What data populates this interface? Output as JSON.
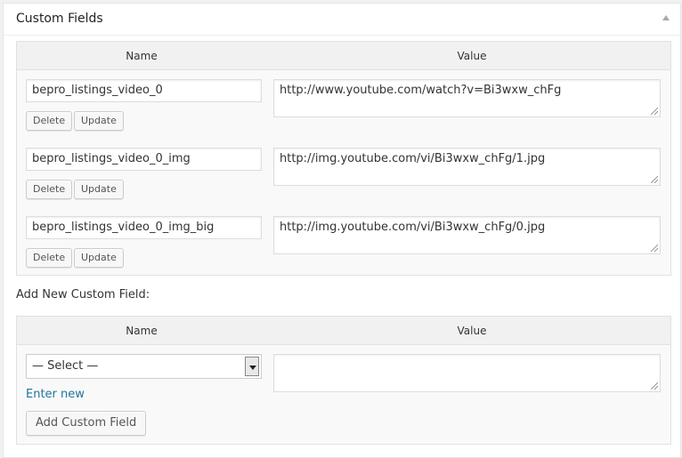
{
  "panel": {
    "title": "Custom Fields",
    "toggle_icon": "triangle-up-icon"
  },
  "existing": {
    "headers": {
      "name": "Name",
      "value": "Value"
    },
    "rows": [
      {
        "name": "bepro_listings_video_0",
        "value": "http://www.youtube.com/watch?v=Bi3wxw_chFg",
        "delete_label": "Delete",
        "update_label": "Update"
      },
      {
        "name": "bepro_listings_video_0_img",
        "value": "http://img.youtube.com/vi/Bi3wxw_chFg/1.jpg",
        "delete_label": "Delete",
        "update_label": "Update"
      },
      {
        "name": "bepro_listings_video_0_img_big",
        "value": "http://img.youtube.com/vi/Bi3wxw_chFg/0.jpg",
        "delete_label": "Delete",
        "update_label": "Update"
      }
    ]
  },
  "add_new": {
    "title": "Add New Custom Field:",
    "headers": {
      "name": "Name",
      "value": "Value"
    },
    "select_value": "— Select —",
    "enter_new_label": "Enter new",
    "add_button_label": "Add Custom Field",
    "value": ""
  },
  "colors": {
    "link": "#21759b",
    "border": "#e1e1e1",
    "header_bg": "#f1f1f1"
  }
}
